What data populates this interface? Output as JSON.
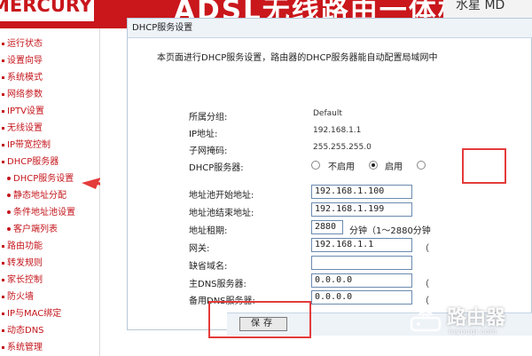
{
  "header": {
    "logo": "MERCURY",
    "product_title": "ADSL无线路由一体机",
    "model": "水星 MD"
  },
  "sidebar": {
    "items": [
      {
        "label": "运行状态",
        "type": "item"
      },
      {
        "label": "设置向导",
        "type": "item"
      },
      {
        "label": "系统模式",
        "type": "item"
      },
      {
        "label": "网络参数",
        "type": "item"
      },
      {
        "label": "IPTV设置",
        "type": "item"
      },
      {
        "label": "无线设置",
        "type": "item"
      },
      {
        "label": "IP带宽控制",
        "type": "item"
      },
      {
        "label": "DHCP服务器",
        "type": "item"
      },
      {
        "label": "DHCP服务设置",
        "type": "sub"
      },
      {
        "label": "静态地址分配",
        "type": "sub"
      },
      {
        "label": "条件地址池设置",
        "type": "sub"
      },
      {
        "label": "客户端列表",
        "type": "sub"
      },
      {
        "label": "路由功能",
        "type": "item"
      },
      {
        "label": "转发规则",
        "type": "item"
      },
      {
        "label": "家长控制",
        "type": "item"
      },
      {
        "label": "防火墙",
        "type": "item"
      },
      {
        "label": "IP与MAC绑定",
        "type": "item"
      },
      {
        "label": "动态DNS",
        "type": "item"
      },
      {
        "label": "系统管理",
        "type": "item"
      }
    ]
  },
  "panel": {
    "title": "DHCP服务设置",
    "description": "本页面进行DHCP服务设置，路由器的DHCP服务器能自动配置局域网中"
  },
  "info": {
    "group_label": "所属分组:",
    "group_value": "Default",
    "ip_label": "IP地址:",
    "ip_value": "192.168.1.1",
    "mask_label": "子网掩码:",
    "mask_value": "255.255.255.0",
    "dhcp_label": "DHCP服务器:",
    "dhcp_disable": "不启用",
    "dhcp_enable": "启用",
    "dhcp_selected": "启用"
  },
  "fields": {
    "pool_start_label": "地址池开始地址:",
    "pool_start_value": "192.168.1.100",
    "pool_end_label": "地址池结束地址:",
    "pool_end_value": "192.168.1.199",
    "lease_label": "地址租期:",
    "lease_value": "2880",
    "lease_hint": "分钟（1～2880分钟",
    "gateway_label": "网关:",
    "gateway_value": "192.168.1.1",
    "gateway_paren": "（",
    "domain_label": "缺省域名:",
    "domain_value": "",
    "dns1_label": "主DNS服务器:",
    "dns1_value": "0.0.0.0",
    "dns1_paren": "（",
    "dns2_label": "备用DNS服务器:",
    "dns2_value": "0.0.0.0",
    "dns2_paren": "（"
  },
  "buttons": {
    "save": "保存"
  },
  "watermark": {
    "text": "路由器",
    "sub": "luyouqi.com"
  },
  "colors": {
    "header_red": "#c9171c",
    "menu_red": "#c4161c",
    "annotation_red": "#e43b3b"
  }
}
